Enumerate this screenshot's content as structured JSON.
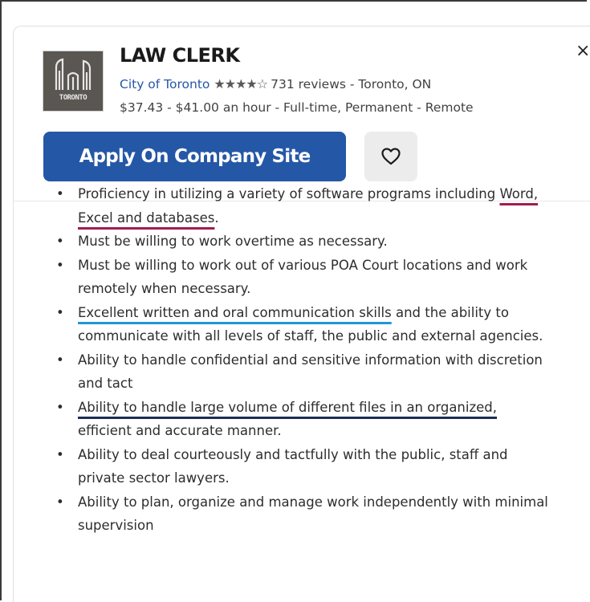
{
  "job": {
    "title": "LAW CLERK",
    "company": "City of Toronto",
    "rating_stars": "★★★★☆",
    "reviews": "731 reviews",
    "location_sep": " - Toronto, ON",
    "salary": "$37.43 - $41.00 an hour - Full-time, Permanent - Remote",
    "logo_text": "TORONTO"
  },
  "actions": {
    "apply_label": "Apply On Company Site",
    "close_label": "×"
  },
  "description": {
    "items": [
      {
        "pre": "Proficiency in utilizing a variety of software programs including ",
        "hl": "Word, Excel and databases",
        "post": "."
      },
      {
        "pre": "Must be willing to work overtime as necessary.",
        "hl": "",
        "post": ""
      },
      {
        "pre": "Must be willing to work out of various POA Court locations and work remotely when necessary.",
        "hl": "",
        "post": ""
      },
      {
        "pre": "",
        "hl": "Excellent written and oral communication skills",
        "post": " and the ability to communicate with all levels of staff, the public and external agencies."
      },
      {
        "pre": "Ability to handle confidential and sensitive information with discretion and tact",
        "hl": "",
        "post": ""
      },
      {
        "pre": "",
        "hl": "Ability to handle large volume of different files in an organized,",
        "post": " efficient and accurate manner."
      },
      {
        "pre": "Ability to deal courteously and tactfully with the public, staff and private sector lawyers.",
        "hl": "",
        "post": ""
      },
      {
        "pre": "Ability to plan, organize and manage work independently with minimal supervision",
        "hl": "",
        "post": ""
      }
    ]
  },
  "colors": {
    "accent": "#2557a7",
    "underline_red": "#a11d4f",
    "underline_cyan": "#2196d8",
    "underline_navy": "#1c2e52"
  }
}
